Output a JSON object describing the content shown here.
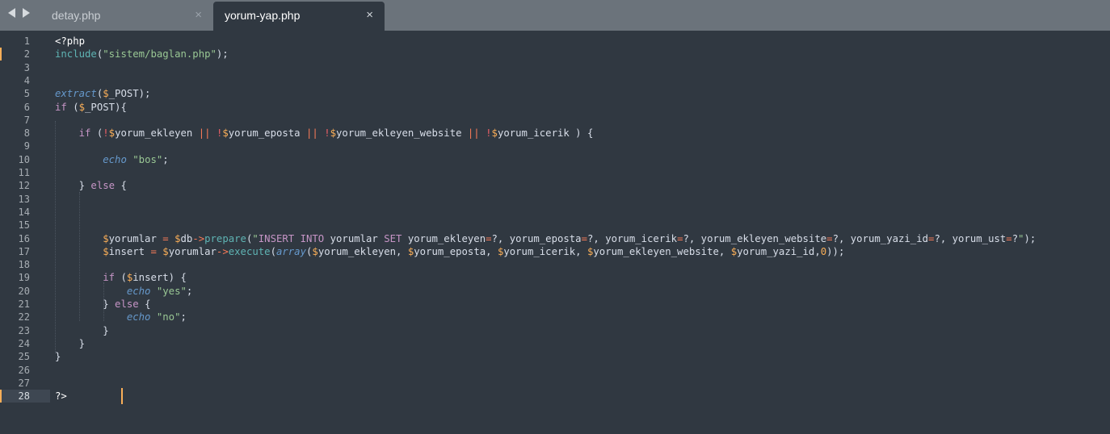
{
  "tabs": [
    {
      "label": "detay.php",
      "close": "×",
      "active": false
    },
    {
      "label": "yorum-yap.php",
      "close": "×",
      "active": true
    }
  ],
  "editor": {
    "active_line": 28,
    "modified_lines": [
      2,
      28
    ],
    "colors": {
      "background": "#303841",
      "tabbar": "#6b737b",
      "keyword": "#c695c6",
      "function": "#5fb4b4",
      "string": "#99c794",
      "variable_sigil": "#f9ae58",
      "operator": "#f97b58",
      "cursor": "#f9ae58"
    },
    "lines": [
      {
        "n": "1",
        "tokens": [
          {
            "t": "<?php",
            "c": "tag"
          }
        ]
      },
      {
        "n": "2",
        "tokens": [
          {
            "t": "include",
            "c": "fn"
          },
          {
            "t": "(",
            "c": "txt"
          },
          {
            "t": "\"sistem/baglan.php\"",
            "c": "str"
          },
          {
            "t": ");",
            "c": "txt"
          }
        ]
      },
      {
        "n": "3",
        "tokens": []
      },
      {
        "n": "4",
        "tokens": []
      },
      {
        "n": "5",
        "tokens": [
          {
            "t": "extract",
            "c": "it"
          },
          {
            "t": "(",
            "c": "txt"
          },
          {
            "t": "$",
            "c": "var"
          },
          {
            "t": "_POST);",
            "c": "txt"
          }
        ]
      },
      {
        "n": "6",
        "tokens": [
          {
            "t": "if",
            "c": "kw"
          },
          {
            "t": " (",
            "c": "txt"
          },
          {
            "t": "$",
            "c": "var"
          },
          {
            "t": "_POST){",
            "c": "txt"
          }
        ]
      },
      {
        "n": "7",
        "tokens": []
      },
      {
        "n": "8",
        "tokens": [
          {
            "t": "    ",
            "c": "txt"
          },
          {
            "t": "if",
            "c": "kw"
          },
          {
            "t": " (",
            "c": "txt"
          },
          {
            "t": "!",
            "c": "ex"
          },
          {
            "t": "$",
            "c": "var"
          },
          {
            "t": "yorum_ekleyen ",
            "c": "txt"
          },
          {
            "t": "||",
            "c": "op"
          },
          {
            "t": " ",
            "c": "txt"
          },
          {
            "t": "!",
            "c": "ex"
          },
          {
            "t": "$",
            "c": "var"
          },
          {
            "t": "yorum_eposta ",
            "c": "txt"
          },
          {
            "t": "||",
            "c": "op"
          },
          {
            "t": " ",
            "c": "txt"
          },
          {
            "t": "!",
            "c": "ex"
          },
          {
            "t": "$",
            "c": "var"
          },
          {
            "t": "yorum_ekleyen_website ",
            "c": "txt"
          },
          {
            "t": "||",
            "c": "op"
          },
          {
            "t": " ",
            "c": "txt"
          },
          {
            "t": "!",
            "c": "ex"
          },
          {
            "t": "$",
            "c": "var"
          },
          {
            "t": "yorum_icerik ) {",
            "c": "txt"
          }
        ]
      },
      {
        "n": "9",
        "tokens": []
      },
      {
        "n": "10",
        "tokens": [
          {
            "t": "        ",
            "c": "txt"
          },
          {
            "t": "echo",
            "c": "it"
          },
          {
            "t": " ",
            "c": "txt"
          },
          {
            "t": "\"bos\"",
            "c": "str"
          },
          {
            "t": ";",
            "c": "txt"
          }
        ]
      },
      {
        "n": "11",
        "tokens": []
      },
      {
        "n": "12",
        "tokens": [
          {
            "t": "    } ",
            "c": "txt"
          },
          {
            "t": "else",
            "c": "kw"
          },
          {
            "t": " {",
            "c": "txt"
          }
        ]
      },
      {
        "n": "13",
        "tokens": []
      },
      {
        "n": "14",
        "tokens": []
      },
      {
        "n": "15",
        "tokens": []
      },
      {
        "n": "16",
        "tokens": [
          {
            "t": "        ",
            "c": "txt"
          },
          {
            "t": "$",
            "c": "var"
          },
          {
            "t": "yorumlar ",
            "c": "txt"
          },
          {
            "t": "=",
            "c": "op"
          },
          {
            "t": " ",
            "c": "txt"
          },
          {
            "t": "$",
            "c": "var"
          },
          {
            "t": "db",
            "c": "txt"
          },
          {
            "t": "->",
            "c": "op"
          },
          {
            "t": "prepare",
            "c": "fn"
          },
          {
            "t": "(",
            "c": "txt"
          },
          {
            "t": "\"",
            "c": "str"
          },
          {
            "t": "INSERT INTO",
            "c": "sqlk"
          },
          {
            "t": " yorumlar ",
            "c": "txt"
          },
          {
            "t": "SET",
            "c": "sqlk"
          },
          {
            "t": " yorum_ekleyen",
            "c": "txt"
          },
          {
            "t": "=",
            "c": "op"
          },
          {
            "t": "?, yorum_eposta",
            "c": "txt"
          },
          {
            "t": "=",
            "c": "op"
          },
          {
            "t": "?, yorum_icerik",
            "c": "txt"
          },
          {
            "t": "=",
            "c": "op"
          },
          {
            "t": "?, yorum_ekleyen_website",
            "c": "txt"
          },
          {
            "t": "=",
            "c": "op"
          },
          {
            "t": "?, yorum_yazi_id",
            "c": "txt"
          },
          {
            "t": "=",
            "c": "op"
          },
          {
            "t": "?, yorum_ust",
            "c": "txt"
          },
          {
            "t": "=",
            "c": "op"
          },
          {
            "t": "?",
            "c": "txt"
          },
          {
            "t": "\"",
            "c": "str"
          },
          {
            "t": ");",
            "c": "txt"
          }
        ]
      },
      {
        "n": "17",
        "tokens": [
          {
            "t": "        ",
            "c": "txt"
          },
          {
            "t": "$",
            "c": "var"
          },
          {
            "t": "insert ",
            "c": "txt"
          },
          {
            "t": "=",
            "c": "op"
          },
          {
            "t": " ",
            "c": "txt"
          },
          {
            "t": "$",
            "c": "var"
          },
          {
            "t": "yorumlar",
            "c": "txt"
          },
          {
            "t": "->",
            "c": "op"
          },
          {
            "t": "execute",
            "c": "fn"
          },
          {
            "t": "(",
            "c": "txt"
          },
          {
            "t": "array",
            "c": "it"
          },
          {
            "t": "(",
            "c": "txt"
          },
          {
            "t": "$",
            "c": "var"
          },
          {
            "t": "yorum_ekleyen, ",
            "c": "txt"
          },
          {
            "t": "$",
            "c": "var"
          },
          {
            "t": "yorum_eposta, ",
            "c": "txt"
          },
          {
            "t": "$",
            "c": "var"
          },
          {
            "t": "yorum_icerik, ",
            "c": "txt"
          },
          {
            "t": "$",
            "c": "var"
          },
          {
            "t": "yorum_ekleyen_website, ",
            "c": "txt"
          },
          {
            "t": "$",
            "c": "var"
          },
          {
            "t": "yorum_yazi_id,",
            "c": "txt"
          },
          {
            "t": "0",
            "c": "num"
          },
          {
            "t": "));",
            "c": "txt"
          }
        ]
      },
      {
        "n": "18",
        "tokens": []
      },
      {
        "n": "19",
        "tokens": [
          {
            "t": "        ",
            "c": "txt"
          },
          {
            "t": "if",
            "c": "kw"
          },
          {
            "t": " (",
            "c": "txt"
          },
          {
            "t": "$",
            "c": "var"
          },
          {
            "t": "insert) {",
            "c": "txt"
          }
        ]
      },
      {
        "n": "20",
        "tokens": [
          {
            "t": "            ",
            "c": "txt"
          },
          {
            "t": "echo",
            "c": "it"
          },
          {
            "t": " ",
            "c": "txt"
          },
          {
            "t": "\"yes\"",
            "c": "str"
          },
          {
            "t": ";",
            "c": "txt"
          }
        ]
      },
      {
        "n": "21",
        "tokens": [
          {
            "t": "        } ",
            "c": "txt"
          },
          {
            "t": "else",
            "c": "kw"
          },
          {
            "t": " {",
            "c": "txt"
          }
        ]
      },
      {
        "n": "22",
        "tokens": [
          {
            "t": "            ",
            "c": "txt"
          },
          {
            "t": "echo",
            "c": "it"
          },
          {
            "t": " ",
            "c": "txt"
          },
          {
            "t": "\"no\"",
            "c": "str"
          },
          {
            "t": ";",
            "c": "txt"
          }
        ]
      },
      {
        "n": "23",
        "tokens": [
          {
            "t": "        }",
            "c": "txt"
          }
        ]
      },
      {
        "n": "24",
        "tokens": [
          {
            "t": "    }",
            "c": "txt"
          }
        ]
      },
      {
        "n": "25",
        "tokens": [
          {
            "t": "}",
            "c": "txt"
          }
        ]
      },
      {
        "n": "26",
        "tokens": []
      },
      {
        "n": "27",
        "tokens": []
      },
      {
        "n": "28",
        "tokens": [
          {
            "t": "?>",
            "c": "tag"
          }
        ]
      }
    ]
  }
}
